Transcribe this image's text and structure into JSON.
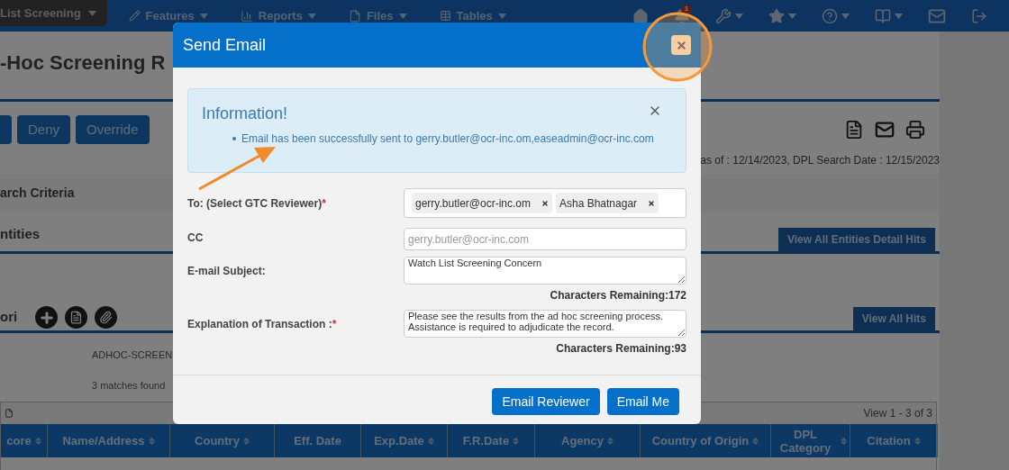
{
  "nav": {
    "menus": [
      {
        "label": "List Screening",
        "kind": "pill"
      },
      {
        "label": "Features",
        "kind": "pencil"
      },
      {
        "label": "Reports",
        "kind": "chart"
      },
      {
        "label": "Files",
        "kind": "file"
      },
      {
        "label": "Tables",
        "kind": "table"
      }
    ],
    "notification_badge": "1"
  },
  "page": {
    "title": "-Hoc Screening R",
    "actions": [
      "Deny",
      "Override"
    ],
    "dates": "as of : 12/14/2023,  DPL Search Date : 12/15/2023",
    "search_criteria": "arch Criteria",
    "entities_heading": "ntities",
    "entities_tab": "View All Entities Detail Hits",
    "hits_heading": "ori",
    "hits_tab": "View All Hits",
    "screen_name": "ADHOC-SCREEN",
    "matches": "3 matches found",
    "table": {
      "view_count": "View 1 - 3 of 3",
      "columns": [
        {
          "label": "core",
          "sortable": true
        },
        {
          "label": "Name/Address",
          "sortable": true
        },
        {
          "label": "Country",
          "sortable": true
        },
        {
          "label": "Eff. Date",
          "sortable": false
        },
        {
          "label": "Exp.Date",
          "sortable": true
        },
        {
          "label": "F.R.Date",
          "sortable": true
        },
        {
          "label": "Agency",
          "sortable": true
        },
        {
          "label": "Country of Origin",
          "sortable": true
        },
        {
          "label": "DPL Category",
          "sortable": true
        },
        {
          "label": "Citation",
          "sortable": true
        }
      ]
    }
  },
  "dialog": {
    "title": "Send Email",
    "alert": {
      "title": "Information!",
      "messages": [
        "Email has been successfully sent to gerry.butler@ocr-inc.om,easeadmin@ocr-inc.com"
      ]
    },
    "fields": [
      {
        "label": "To: (Select GTC Reviewer)",
        "required_mark": "*",
        "kind": "tags",
        "tags": [
          "gerry.butler@ocr-inc.om",
          "Asha Bhatnagar"
        ]
      },
      {
        "label": "CC",
        "kind": "input",
        "placeholder": "gerry.butler@ocr-inc.com"
      },
      {
        "label": "E-mail Subject:",
        "kind": "textarea",
        "value": "Watch List Screening Concern",
        "counter": "Characters Remaining:172"
      },
      {
        "label": "Explanation of Transaction :",
        "required_mark": "*",
        "kind": "textarea",
        "value": "Please see the results from the ad hoc screening process. Assistance is required to adjudicate the record.",
        "counter": "Characters Remaining:93"
      }
    ],
    "buttons": [
      "Email Reviewer",
      "Email Me"
    ]
  }
}
